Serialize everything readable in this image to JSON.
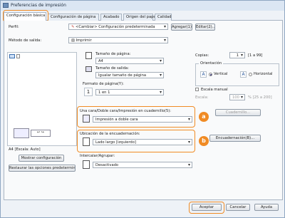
{
  "window": {
    "title": "Preferencias de impresión"
  },
  "tabs": [
    {
      "label": "Configuración básica"
    },
    {
      "label": "Configuración de página"
    },
    {
      "label": "Acabado"
    },
    {
      "label": "Origen del papel"
    },
    {
      "label": "Calidad"
    }
  ],
  "profile": {
    "label": "Perfil:",
    "value": "<Cambiar> Configuración predeterminada",
    "add": "Agregar(1)...",
    "edit": "Editar(2)..."
  },
  "output": {
    "label": "Método de salida:",
    "value": "Imprimir"
  },
  "preview": {
    "caption": "A4 [Escala: Auto]",
    "show_settings": "Mostrar configuración",
    "restore": "Restaurar las opciones predeterminadas"
  },
  "page_size": {
    "label": "Tamaño de página:",
    "value": "A4"
  },
  "output_size": {
    "label": "Tamaño de salida:",
    "value": "Igualar tamaño de página"
  },
  "layout": {
    "label": "Formato de página(Y):",
    "value": "1 en 1",
    "num": "1"
  },
  "duplex": {
    "label": "Una cara/Doble cara/Impresión en cuadernillo(5):",
    "value": "Impresión a doble cara",
    "booklet": "Cuadernillo..."
  },
  "binding": {
    "label": "Ubicación de la encuadernación:",
    "value": "Lado largo [izquierdo]",
    "button": "Encuadernación(B)..."
  },
  "collate": {
    "label": "Intercalar/Agrupar:",
    "value": "Desactivado"
  },
  "copies": {
    "label": "Copias:",
    "value": "1",
    "range": "[1 a 99]"
  },
  "orientation": {
    "label": "Orientación",
    "vertical": "Vertical",
    "horizontal": "Horizontal"
  },
  "scaling": {
    "manual": "Escala manual",
    "label": "Escala:",
    "value": "100",
    "range": "% [25 a 200]"
  },
  "badges": {
    "a": "a",
    "b": "b"
  },
  "footer": {
    "ok": "Aceptar",
    "cancel": "Cancelar",
    "help": "Ayuda"
  },
  "colors": {
    "highlight": "#f08b24",
    "chrome": "#dbe6f3"
  }
}
